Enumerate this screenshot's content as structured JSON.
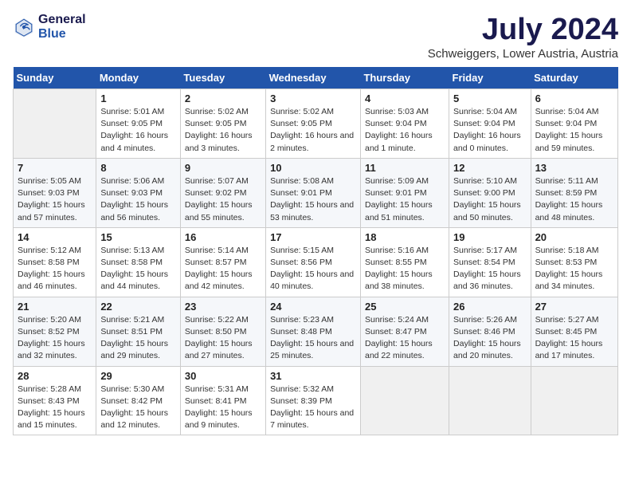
{
  "header": {
    "logo_line1": "General",
    "logo_line2": "Blue",
    "title": "July 2024",
    "subtitle": "Schweiggers, Lower Austria, Austria"
  },
  "days_of_week": [
    "Sunday",
    "Monday",
    "Tuesday",
    "Wednesday",
    "Thursday",
    "Friday",
    "Saturday"
  ],
  "weeks": [
    [
      {
        "day": "",
        "sunrise": "",
        "sunset": "",
        "daylight": ""
      },
      {
        "day": "1",
        "sunrise": "Sunrise: 5:01 AM",
        "sunset": "Sunset: 9:05 PM",
        "daylight": "Daylight: 16 hours and 4 minutes."
      },
      {
        "day": "2",
        "sunrise": "Sunrise: 5:02 AM",
        "sunset": "Sunset: 9:05 PM",
        "daylight": "Daylight: 16 hours and 3 minutes."
      },
      {
        "day": "3",
        "sunrise": "Sunrise: 5:02 AM",
        "sunset": "Sunset: 9:05 PM",
        "daylight": "Daylight: 16 hours and 2 minutes."
      },
      {
        "day": "4",
        "sunrise": "Sunrise: 5:03 AM",
        "sunset": "Sunset: 9:04 PM",
        "daylight": "Daylight: 16 hours and 1 minute."
      },
      {
        "day": "5",
        "sunrise": "Sunrise: 5:04 AM",
        "sunset": "Sunset: 9:04 PM",
        "daylight": "Daylight: 16 hours and 0 minutes."
      },
      {
        "day": "6",
        "sunrise": "Sunrise: 5:04 AM",
        "sunset": "Sunset: 9:04 PM",
        "daylight": "Daylight: 15 hours and 59 minutes."
      }
    ],
    [
      {
        "day": "7",
        "sunrise": "Sunrise: 5:05 AM",
        "sunset": "Sunset: 9:03 PM",
        "daylight": "Daylight: 15 hours and 57 minutes."
      },
      {
        "day": "8",
        "sunrise": "Sunrise: 5:06 AM",
        "sunset": "Sunset: 9:03 PM",
        "daylight": "Daylight: 15 hours and 56 minutes."
      },
      {
        "day": "9",
        "sunrise": "Sunrise: 5:07 AM",
        "sunset": "Sunset: 9:02 PM",
        "daylight": "Daylight: 15 hours and 55 minutes."
      },
      {
        "day": "10",
        "sunrise": "Sunrise: 5:08 AM",
        "sunset": "Sunset: 9:01 PM",
        "daylight": "Daylight: 15 hours and 53 minutes."
      },
      {
        "day": "11",
        "sunrise": "Sunrise: 5:09 AM",
        "sunset": "Sunset: 9:01 PM",
        "daylight": "Daylight: 15 hours and 51 minutes."
      },
      {
        "day": "12",
        "sunrise": "Sunrise: 5:10 AM",
        "sunset": "Sunset: 9:00 PM",
        "daylight": "Daylight: 15 hours and 50 minutes."
      },
      {
        "day": "13",
        "sunrise": "Sunrise: 5:11 AM",
        "sunset": "Sunset: 8:59 PM",
        "daylight": "Daylight: 15 hours and 48 minutes."
      }
    ],
    [
      {
        "day": "14",
        "sunrise": "Sunrise: 5:12 AM",
        "sunset": "Sunset: 8:58 PM",
        "daylight": "Daylight: 15 hours and 46 minutes."
      },
      {
        "day": "15",
        "sunrise": "Sunrise: 5:13 AM",
        "sunset": "Sunset: 8:58 PM",
        "daylight": "Daylight: 15 hours and 44 minutes."
      },
      {
        "day": "16",
        "sunrise": "Sunrise: 5:14 AM",
        "sunset": "Sunset: 8:57 PM",
        "daylight": "Daylight: 15 hours and 42 minutes."
      },
      {
        "day": "17",
        "sunrise": "Sunrise: 5:15 AM",
        "sunset": "Sunset: 8:56 PM",
        "daylight": "Daylight: 15 hours and 40 minutes."
      },
      {
        "day": "18",
        "sunrise": "Sunrise: 5:16 AM",
        "sunset": "Sunset: 8:55 PM",
        "daylight": "Daylight: 15 hours and 38 minutes."
      },
      {
        "day": "19",
        "sunrise": "Sunrise: 5:17 AM",
        "sunset": "Sunset: 8:54 PM",
        "daylight": "Daylight: 15 hours and 36 minutes."
      },
      {
        "day": "20",
        "sunrise": "Sunrise: 5:18 AM",
        "sunset": "Sunset: 8:53 PM",
        "daylight": "Daylight: 15 hours and 34 minutes."
      }
    ],
    [
      {
        "day": "21",
        "sunrise": "Sunrise: 5:20 AM",
        "sunset": "Sunset: 8:52 PM",
        "daylight": "Daylight: 15 hours and 32 minutes."
      },
      {
        "day": "22",
        "sunrise": "Sunrise: 5:21 AM",
        "sunset": "Sunset: 8:51 PM",
        "daylight": "Daylight: 15 hours and 29 minutes."
      },
      {
        "day": "23",
        "sunrise": "Sunrise: 5:22 AM",
        "sunset": "Sunset: 8:50 PM",
        "daylight": "Daylight: 15 hours and 27 minutes."
      },
      {
        "day": "24",
        "sunrise": "Sunrise: 5:23 AM",
        "sunset": "Sunset: 8:48 PM",
        "daylight": "Daylight: 15 hours and 25 minutes."
      },
      {
        "day": "25",
        "sunrise": "Sunrise: 5:24 AM",
        "sunset": "Sunset: 8:47 PM",
        "daylight": "Daylight: 15 hours and 22 minutes."
      },
      {
        "day": "26",
        "sunrise": "Sunrise: 5:26 AM",
        "sunset": "Sunset: 8:46 PM",
        "daylight": "Daylight: 15 hours and 20 minutes."
      },
      {
        "day": "27",
        "sunrise": "Sunrise: 5:27 AM",
        "sunset": "Sunset: 8:45 PM",
        "daylight": "Daylight: 15 hours and 17 minutes."
      }
    ],
    [
      {
        "day": "28",
        "sunrise": "Sunrise: 5:28 AM",
        "sunset": "Sunset: 8:43 PM",
        "daylight": "Daylight: 15 hours and 15 minutes."
      },
      {
        "day": "29",
        "sunrise": "Sunrise: 5:30 AM",
        "sunset": "Sunset: 8:42 PM",
        "daylight": "Daylight: 15 hours and 12 minutes."
      },
      {
        "day": "30",
        "sunrise": "Sunrise: 5:31 AM",
        "sunset": "Sunset: 8:41 PM",
        "daylight": "Daylight: 15 hours and 9 minutes."
      },
      {
        "day": "31",
        "sunrise": "Sunrise: 5:32 AM",
        "sunset": "Sunset: 8:39 PM",
        "daylight": "Daylight: 15 hours and 7 minutes."
      },
      {
        "day": "",
        "sunrise": "",
        "sunset": "",
        "daylight": ""
      },
      {
        "day": "",
        "sunrise": "",
        "sunset": "",
        "daylight": ""
      },
      {
        "day": "",
        "sunrise": "",
        "sunset": "",
        "daylight": ""
      }
    ]
  ]
}
